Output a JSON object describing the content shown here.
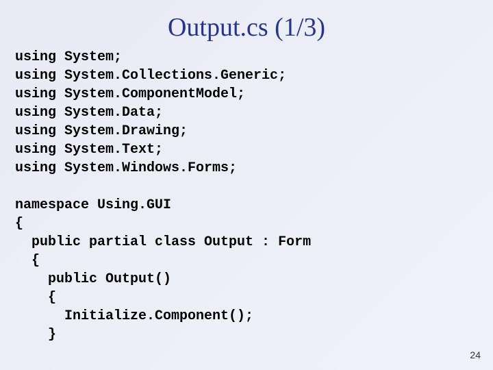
{
  "title": "Output.cs (1/3)",
  "code_lines": [
    "using System;",
    "using System.Collections.Generic;",
    "using System.ComponentModel;",
    "using System.Data;",
    "using System.Drawing;",
    "using System.Text;",
    "using System.Windows.Forms;",
    "",
    "namespace Using.GUI",
    "{",
    "  public partial class Output : Form",
    "  {",
    "    public Output()",
    "    {",
    "      Initialize.Component();",
    "    }"
  ],
  "page_number": "24"
}
